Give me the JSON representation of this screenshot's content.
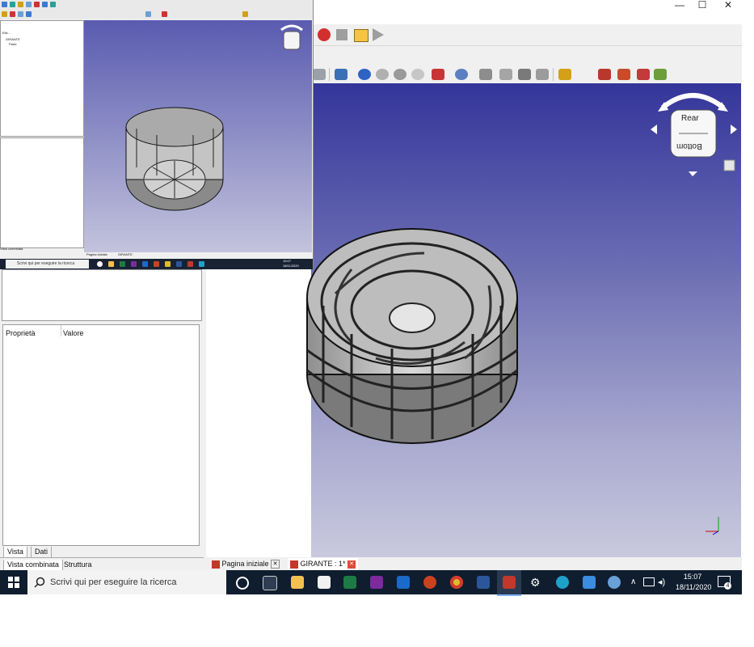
{
  "window": {
    "minimize": "—",
    "maximize": "☐",
    "close": "✕"
  },
  "properties": {
    "col_property": "Proprietà",
    "col_value": "Valore"
  },
  "panel_tabs": {
    "view": "Vista",
    "data": "Dati"
  },
  "combo_tabs": {
    "combined_view": "Vista combinata",
    "structure": "Struttura"
  },
  "document_tabs": [
    {
      "label": "Pagina iniziale"
    },
    {
      "label": "GIRANTE : 1*"
    }
  ],
  "navcube": {
    "top_face": "Rear",
    "bottom_face": "Bottom"
  },
  "taskbar": {
    "search_placeholder": "Scrivi qui per eseguire la ricerca",
    "time": "15:07",
    "date": "18/11/2020",
    "notifications": "4"
  },
  "inset": {
    "tree_tab_label": "Etic...",
    "tree_item_1": "GIRANTE",
    "tree_item_2": "Parte",
    "search_placeholder": "Scrivi qui per eseguire la ricerca",
    "time": "15:07",
    "date": "18/11/2020",
    "tab_a": "Vista combinata",
    "tab_b": "Pagina iniziale",
    "tab_c": "GIRANTE"
  },
  "colors": {
    "accent_red": "#d32f2f",
    "taskbar": "#0f1d2f",
    "viewport_top": "#34359a",
    "viewport_bottom": "#c9c9de"
  }
}
